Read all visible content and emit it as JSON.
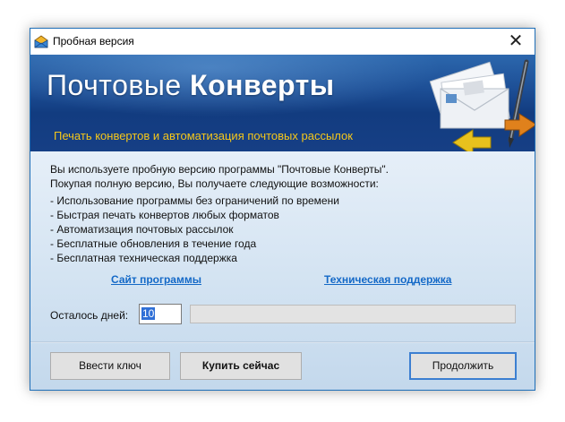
{
  "window": {
    "title": "Пробная версия",
    "close_glyph": "✕",
    "app_icon": "envelope-icon"
  },
  "banner": {
    "title_light": "Почтовые ",
    "title_bold": "Конверты",
    "subtitle": "Печать конвертов и автоматизация почтовых рассылок",
    "illustration": "envelopes-pen-arrows-illustration",
    "subtitle_color": "#f5c71a"
  },
  "intro": [
    "Вы используете пробную версию программы \"Почтовые Конверты\".",
    "Покупая полную версию, Вы получаете следующие возможности:"
  ],
  "features": [
    "- Использование программы без ограничений по времени",
    "- Быстрая печать конвертов любых форматов",
    "- Автоматизация почтовых рассылок",
    "- Бесплатные обновления в течение года",
    "- Бесплатная техническая поддержка"
  ],
  "links": {
    "site": "Сайт программы",
    "support": "Техническая поддержка",
    "color": "#1469c7"
  },
  "days": {
    "label": "Осталось дней:",
    "value": "10",
    "progress_fraction": 0
  },
  "buttons": {
    "enter_key": "Ввести ключ",
    "buy_now": "Купить сейчас",
    "continue": "Продолжить"
  }
}
